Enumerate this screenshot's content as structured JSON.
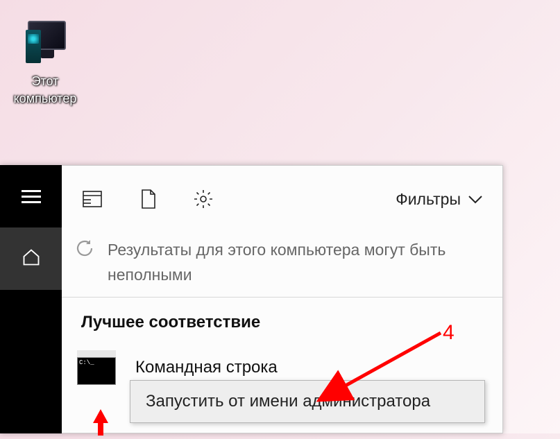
{
  "desktop": {
    "this_pc_label": "Этот\nкомпьютер"
  },
  "search": {
    "filters_label": "Фильтры",
    "info_message": "Результаты для этого компьютера могут быть неполными",
    "best_match_heading": "Лучшее соответствие",
    "result_title": "Командная строка"
  },
  "context_menu": {
    "run_as_admin": "Запустить от имени администратора"
  },
  "annotations": {
    "step4": "4"
  }
}
